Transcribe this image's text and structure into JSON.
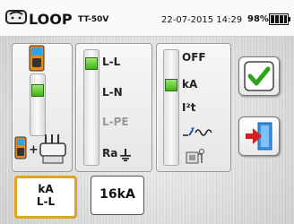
{
  "header": {
    "title": "LOOP",
    "model": "TT-50V",
    "datetime": "22-07-2015 14:29",
    "battery": "98%"
  },
  "connection_panel": {
    "selected_index": 0,
    "adapter_plus": "+"
  },
  "system_options": [
    "L-L",
    "L-N",
    "L-PE",
    "Ra"
  ],
  "system_selected": "L-L",
  "mode_options": [
    "OFF",
    "kA",
    "I²t",
    ""
  ],
  "mode_selected": "kA",
  "mode_icons": [
    "trip-curve-icon",
    "fuse-icon"
  ],
  "buttons": {
    "confirm": "check-icon",
    "exit": "exit-door-icon"
  },
  "tabs": [
    {
      "line1": "kA",
      "line2": "L-L",
      "active": true
    },
    {
      "line1": "16kA",
      "active": false
    }
  ],
  "colors": {
    "accent_green": "#3fb417",
    "tab_active_border": "#e3a322",
    "exit_red": "#d81e1e",
    "exit_blue": "#1e73c8"
  }
}
